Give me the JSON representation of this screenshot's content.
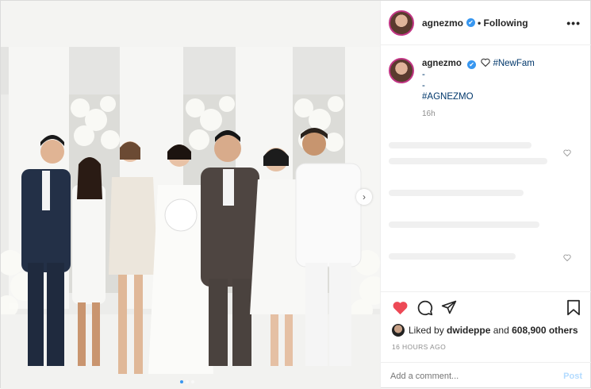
{
  "header": {
    "username": "agnezmo",
    "verified_glyph": "✔",
    "follow_status": "• Following",
    "more_glyph": "•••"
  },
  "caption": {
    "username": "agnezmo",
    "line1": "#NewFam",
    "line2": "-",
    "line3": "-",
    "line4": "#AGNEZMO",
    "age": "16h"
  },
  "actions": {
    "icons": [
      "heart-filled-icon",
      "comment-icon",
      "share-icon",
      "bookmark-icon"
    ],
    "like_color": "#ed4956"
  },
  "likes": {
    "prefix": "Liked by ",
    "user": "dwideppe",
    "middle": " and ",
    "count": "608,900 others"
  },
  "timestamp": "16 HOURS AGO",
  "comment_box": {
    "placeholder": "Add a comment...",
    "post_label": "Post"
  },
  "carousel": {
    "next_glyph": "›",
    "total": 3,
    "active": 1
  }
}
